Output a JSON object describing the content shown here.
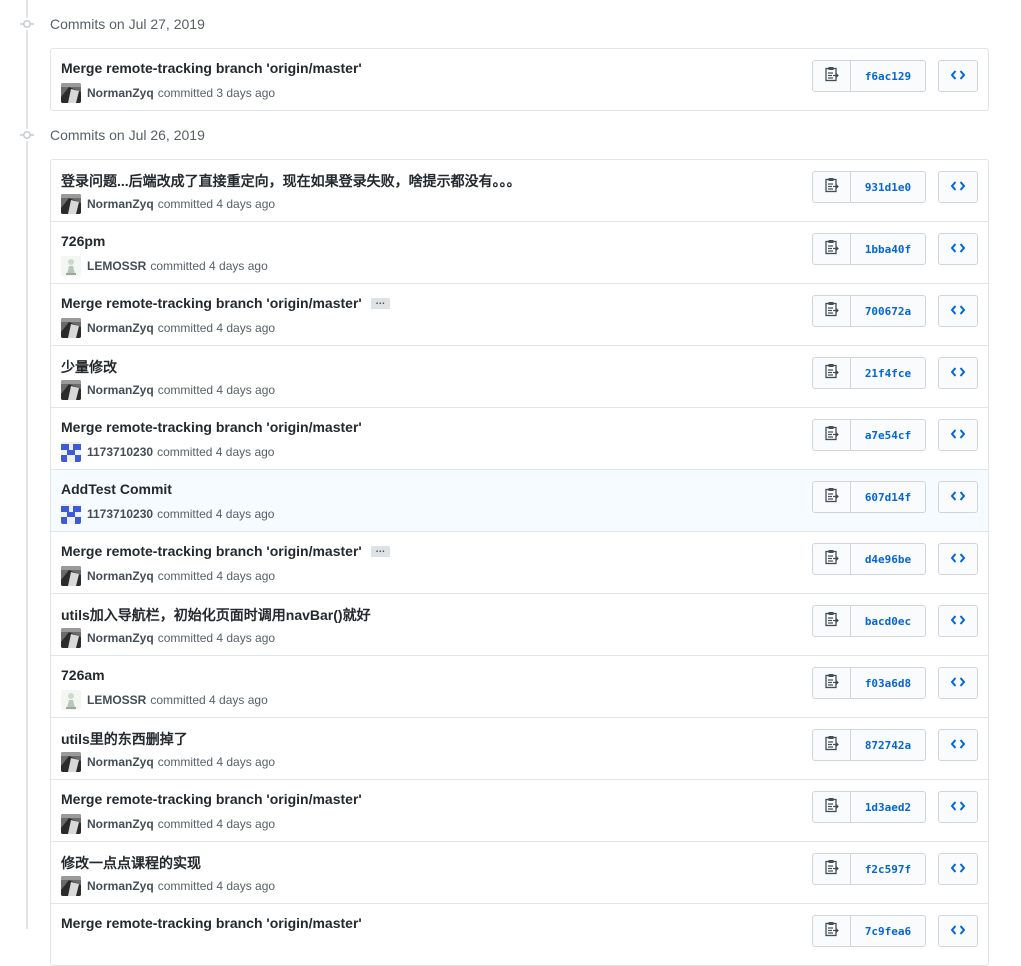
{
  "groups": [
    {
      "title": "Commits on Jul 27, 2019",
      "commits": [
        {
          "message": "Merge remote-tracking branch 'origin/master'",
          "author": "NormanZyq",
          "avatar": "photo",
          "time": "committed 3 days ago",
          "sha": "f6ac129",
          "ellipsis": false
        }
      ]
    },
    {
      "title": "Commits on Jul 26, 2019",
      "commits": [
        {
          "message": "登录问题...后端改成了直接重定向，现在如果登录失败，啥提示都没有。。。",
          "author": "NormanZyq",
          "avatar": "photo",
          "time": "committed 4 days ago",
          "sha": "931d1e0",
          "ellipsis": false
        },
        {
          "message": "726pm",
          "author": "LEMOSSR",
          "avatar": "figure",
          "time": "committed 4 days ago",
          "sha": "1bba40f",
          "ellipsis": false
        },
        {
          "message": "Merge remote-tracking branch 'origin/master'",
          "author": "NormanZyq",
          "avatar": "photo",
          "time": "committed 4 days ago",
          "sha": "700672a",
          "ellipsis": true
        },
        {
          "message": "少量修改",
          "author": "NormanZyq",
          "avatar": "photo",
          "time": "committed 4 days ago",
          "sha": "21f4fce",
          "ellipsis": false
        },
        {
          "message": "Merge remote-tracking branch 'origin/master'",
          "author": "1173710230",
          "avatar": "identicon",
          "time": "committed 4 days ago",
          "sha": "a7e54cf",
          "ellipsis": false
        },
        {
          "message": "AddTest Commit",
          "author": "1173710230",
          "avatar": "identicon",
          "time": "committed 4 days ago",
          "sha": "607d14f",
          "ellipsis": false,
          "highlighted": true
        },
        {
          "message": "Merge remote-tracking branch 'origin/master'",
          "author": "NormanZyq",
          "avatar": "photo",
          "time": "committed 4 days ago",
          "sha": "d4e96be",
          "ellipsis": true
        },
        {
          "message": "utils加入导航栏，初始化页面时调用navBar()就好",
          "author": "NormanZyq",
          "avatar": "photo",
          "time": "committed 4 days ago",
          "sha": "bacd0ec",
          "ellipsis": false
        },
        {
          "message": "726am",
          "author": "LEMOSSR",
          "avatar": "figure",
          "time": "committed 4 days ago",
          "sha": "f03a6d8",
          "ellipsis": false
        },
        {
          "message": "utils里的东西删掉了",
          "author": "NormanZyq",
          "avatar": "photo",
          "time": "committed 4 days ago",
          "sha": "872742a",
          "ellipsis": false
        },
        {
          "message": "Merge remote-tracking branch 'origin/master'",
          "author": "NormanZyq",
          "avatar": "photo",
          "time": "committed 4 days ago",
          "sha": "1d3aed2",
          "ellipsis": false
        },
        {
          "message": "修改一点点课程的实现",
          "author": "NormanZyq",
          "avatar": "photo",
          "time": "committed 4 days ago",
          "sha": "f2c597f",
          "ellipsis": false
        },
        {
          "message": "Merge remote-tracking branch 'origin/master'",
          "author": "",
          "avatar": "",
          "time": "",
          "sha": "7c9fea6",
          "ellipsis": false
        }
      ]
    }
  ],
  "ellipsis_text": "…",
  "colors": {
    "link": "#0366d6",
    "border": "#e1e4e8",
    "identicon": "#3b5bdb"
  }
}
